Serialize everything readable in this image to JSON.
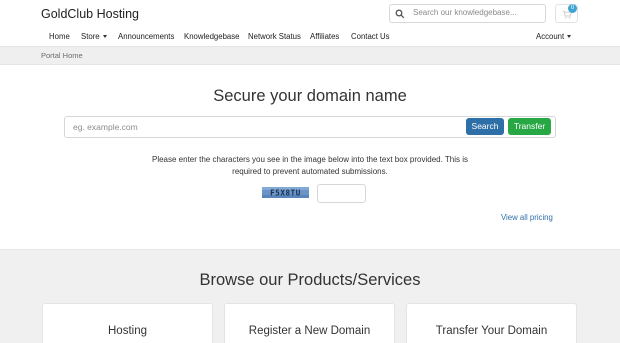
{
  "header": {
    "brand": "GoldClub Hosting",
    "search_placeholder": "Search our knowledgebase...",
    "cart_count": "0"
  },
  "nav": {
    "items": [
      "Home",
      "Store",
      "Announcements",
      "Knowledgebase",
      "Network Status",
      "Affiliates",
      "Contact Us"
    ],
    "account": "Account"
  },
  "breadcrumb": {
    "current": "Portal Home"
  },
  "domain": {
    "title": "Secure your domain name",
    "input_placeholder": "eg. example.com",
    "search_label": "Search",
    "transfer_label": "Transfer",
    "captcha_prompt": "Please enter the characters you see in the image below into the text box provided. This is required to prevent automated submissions.",
    "captcha_code": "F5X8TU",
    "pricing_link": "View all pricing"
  },
  "products": {
    "title": "Browse our Products/Services",
    "cards": [
      "Hosting",
      "Register a New Domain",
      "Transfer Your Domain"
    ]
  },
  "colors": {
    "primary": "#2f6fa8",
    "success": "#28a745",
    "badge": "#40a4d3"
  }
}
